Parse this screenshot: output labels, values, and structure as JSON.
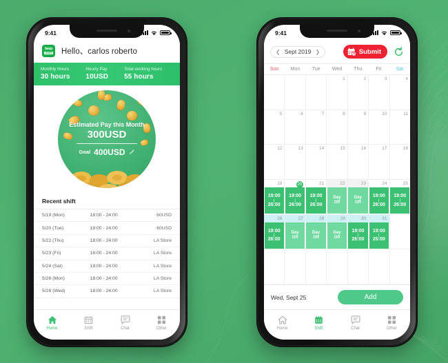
{
  "background": {
    "color": "#4caf6e"
  },
  "status_bar": {
    "time": "9:41",
    "icons": [
      "signal-bars",
      "wifi",
      "battery"
    ]
  },
  "left_phone": {
    "header": {
      "logo_line1": "beep",
      "logo_line2": "shift",
      "greeting": "Hello、carlos roberto"
    },
    "stats": [
      {
        "label": "Monthly Hours",
        "value": "30 hours"
      },
      {
        "label": "Hourly Pay",
        "value": "10USD"
      },
      {
        "label": "Total working hours",
        "value": "55 hours"
      }
    ],
    "pay_circle": {
      "estimate_label": "Estimated Pay this Month",
      "estimate_value": "300USD",
      "goal_label": "Goal",
      "goal_value": "400USD",
      "edit_icon": "pencil-icon"
    },
    "recent_shift": {
      "title": "Recent shift",
      "rows": [
        {
          "date": "5/19 (Mon)",
          "time": "18:00 - 24:00",
          "meta": "60USD"
        },
        {
          "date": "5/20 (Tue)",
          "time": "18:00 - 24:00",
          "meta": "60USD"
        },
        {
          "date": "5/22 (Thu)",
          "time": "18:00 - 24:00",
          "meta": "LA Store"
        },
        {
          "date": "5/23 (Fri)",
          "time": "18:00 - 24:00",
          "meta": "LA Store"
        },
        {
          "date": "5/24 (Sat)",
          "time": "18:00 - 24:00",
          "meta": "LA Store"
        },
        {
          "date": "5/26 (Mon)",
          "time": "18:00 - 24:00",
          "meta": "LA Store"
        },
        {
          "date": "5/28 (Wed)",
          "time": "18:00 - 24:00",
          "meta": "LA Store"
        }
      ]
    },
    "tabs": [
      {
        "label": "Home",
        "icon": "home-icon",
        "active": true
      },
      {
        "label": "Shift",
        "icon": "calendar-icon",
        "active": false
      },
      {
        "label": "Chat",
        "icon": "chat-icon",
        "active": false
      },
      {
        "label": "Other",
        "icon": "grid-icon",
        "active": false
      }
    ]
  },
  "right_phone": {
    "calendar_header": {
      "prev_icon": "chevron-left-icon",
      "month": "Sept 2019",
      "next_icon": "chevron-right-icon",
      "submit_label": "Submit",
      "submit_icon": "calendar-clock-icon",
      "submit_color": "#ee2233",
      "refresh_icon": "refresh-icon"
    },
    "day_headers": [
      "Sun",
      "Mon",
      "Tue",
      "Wed",
      "Thu",
      "Fri",
      "Sat"
    ],
    "weeks": [
      [
        {
          "day": ""
        },
        {
          "day": ""
        },
        {
          "day": ""
        },
        {
          "day": "1"
        },
        {
          "day": "2"
        },
        {
          "day": "3"
        },
        {
          "day": "4"
        }
      ],
      [
        {
          "day": "5"
        },
        {
          "day": "6"
        },
        {
          "day": "7"
        },
        {
          "day": "8"
        },
        {
          "day": "9"
        },
        {
          "day": "10"
        },
        {
          "day": "11"
        }
      ],
      [
        {
          "day": "12"
        },
        {
          "day": "13"
        },
        {
          "day": "14"
        },
        {
          "day": "15"
        },
        {
          "day": "16"
        },
        {
          "day": "17"
        },
        {
          "day": "18"
        }
      ],
      [
        {
          "day": "19",
          "event": "work",
          "start": "19:00",
          "end": "26:00"
        },
        {
          "day": "20",
          "today": true,
          "event": "work",
          "start": "19:00",
          "end": "26:00"
        },
        {
          "day": "21",
          "event": "work",
          "start": "19:00",
          "end": "26:00"
        },
        {
          "day": "22",
          "head": "grey",
          "event": "off",
          "text": "Day Off"
        },
        {
          "day": "23",
          "head": "grey",
          "event": "off",
          "text": "Day Off"
        },
        {
          "day": "24",
          "event": "work",
          "start": "19:00",
          "end": "26:00"
        },
        {
          "day": "25",
          "event": "work",
          "start": "19:00",
          "end": "26:00"
        }
      ],
      [
        {
          "day": "26",
          "head": "cyan",
          "event": "work",
          "start": "19:00",
          "end": "26:00"
        },
        {
          "day": "27",
          "head": "cyan",
          "event": "off",
          "text": "Day Off"
        },
        {
          "day": "28",
          "head": "cyan",
          "event": "off",
          "text": "Day Off"
        },
        {
          "day": "29",
          "head": "cyan",
          "event": "off",
          "text": "Day Off"
        },
        {
          "day": "30",
          "head": "cyan",
          "event": "work",
          "start": "19:00",
          "end": "26:00"
        },
        {
          "day": "31",
          "head": "cyan",
          "event": "work",
          "start": "19:00",
          "end": "26:00"
        },
        {
          "day": ""
        }
      ],
      [
        {
          "day": ""
        },
        {
          "day": ""
        },
        {
          "day": ""
        },
        {
          "day": ""
        },
        {
          "day": ""
        },
        {
          "day": ""
        },
        {
          "day": ""
        }
      ]
    ],
    "footer": {
      "selected_date": "Wed, Sept 25",
      "add_label": "Add",
      "add_color": "#4ec98a"
    },
    "tabs": [
      {
        "label": "Home",
        "icon": "home-icon",
        "active": false
      },
      {
        "label": "Shift",
        "icon": "calendar-icon",
        "active": true
      },
      {
        "label": "Chat",
        "icon": "chat-icon",
        "active": false
      },
      {
        "label": "Other",
        "icon": "grid-icon",
        "active": false
      }
    ]
  }
}
